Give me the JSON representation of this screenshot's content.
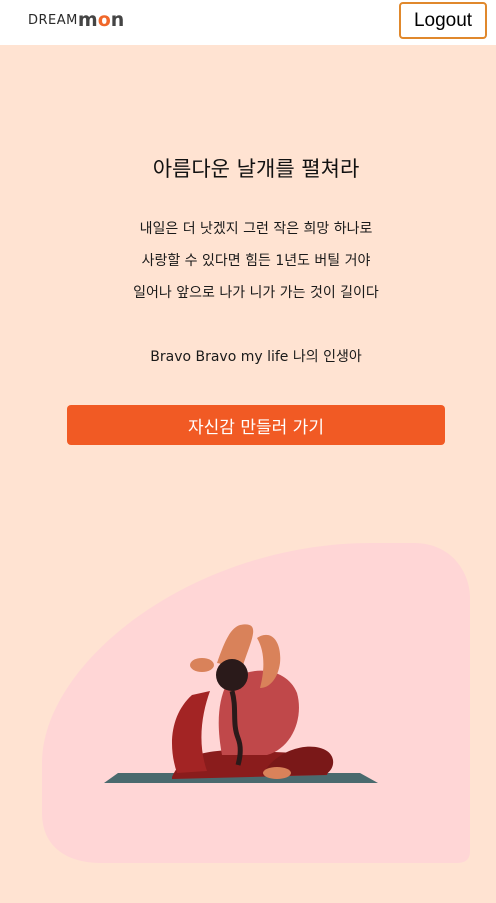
{
  "header": {
    "logo": {
      "dream": "DREAM",
      "mon_m": "m",
      "mon_o": "o",
      "mon_n": "n"
    },
    "logout_label": "Logout",
    "accent_color": "#e0882c"
  },
  "main": {
    "title": "아름다운 날개를 펼쳐라",
    "lyrics": [
      "내일은 더 낫겠지 그런 작은 희망 하나로",
      "사랑할 수 있다면 힘든 1년도 버틸 거야",
      "일어나 앞으로 나가 니가 가는 것이 길이다",
      "Bravo Bravo my life 나의 인생아"
    ],
    "cta_label": "자신감 만들러 가기",
    "cta_color": "#f15a24"
  },
  "illustration": {
    "icon": "yoga-pose-icon",
    "background_color": "#ffd6d6"
  }
}
